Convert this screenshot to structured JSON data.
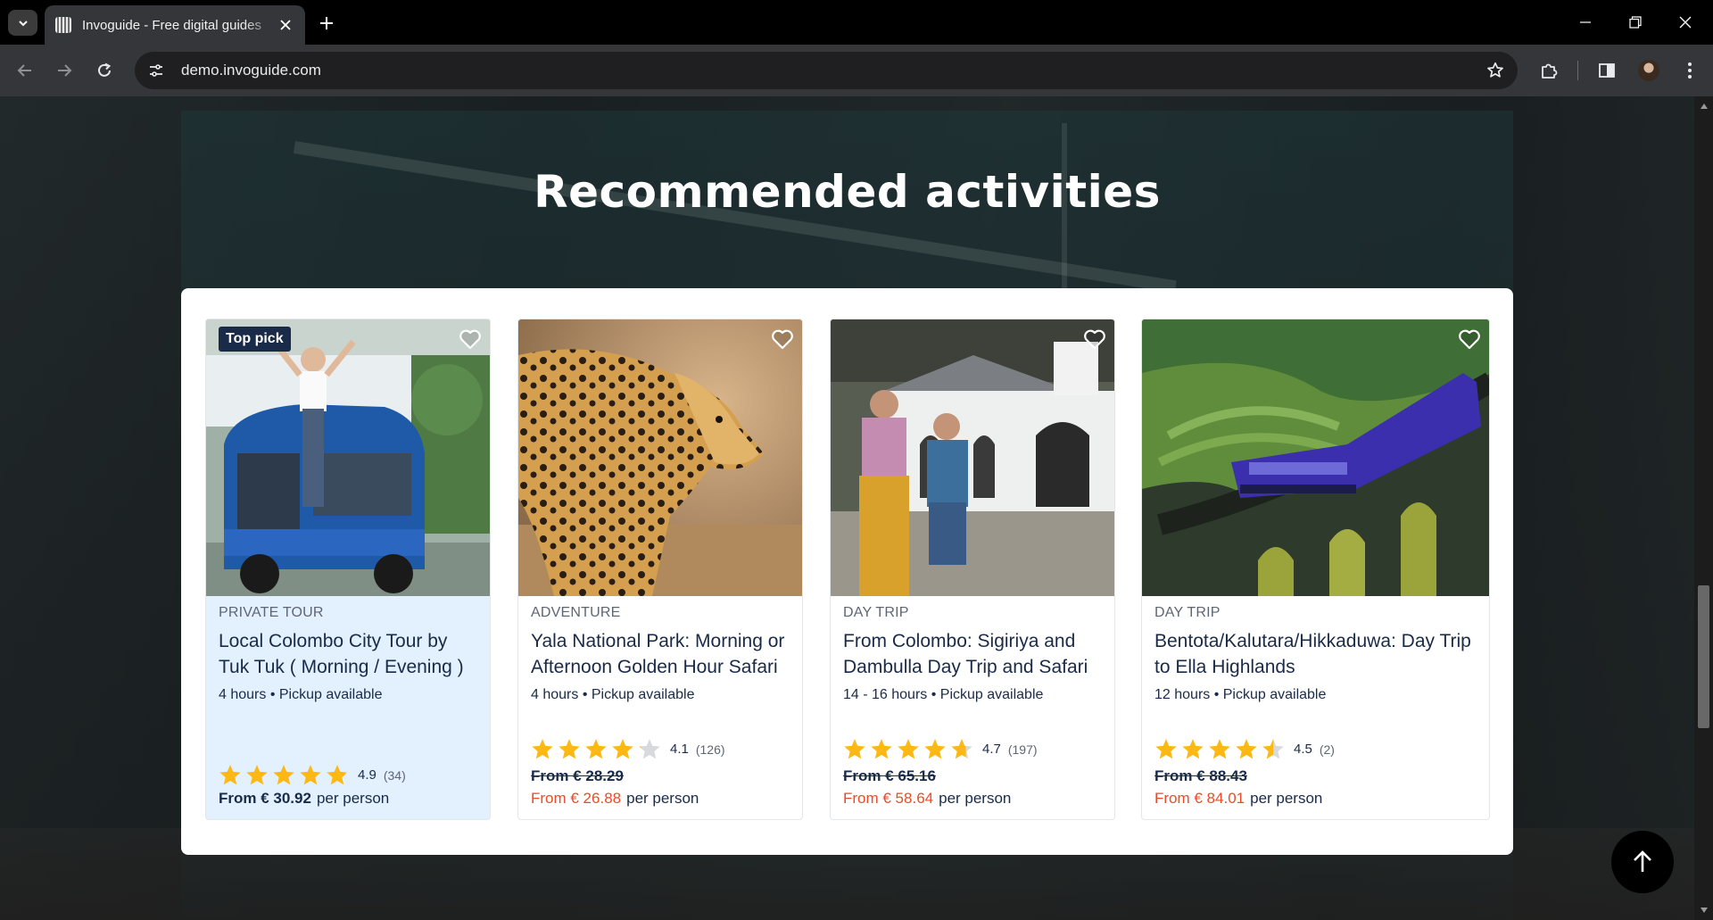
{
  "browser": {
    "tab_title": "Invoguide - Free digital guides",
    "url": "demo.invoguide.com"
  },
  "page": {
    "section_title": "Recommended activities"
  },
  "cards": [
    {
      "badge": "Top pick",
      "category": "PRIVATE TOUR",
      "title": "Local Colombo City Tour by Tuk Tuk ( Morning / Evening )",
      "meta": "4 hours • Pickup available",
      "rating": 4.9,
      "rating_value": "4.9",
      "rating_count": "(34)",
      "old_price": "",
      "price": "From € 30.92",
      "per": "per person",
      "highlight": true
    },
    {
      "category": "ADVENTURE",
      "title": "Yala National Park: Morning or Afternoon Golden Hour Safari",
      "meta": "4 hours • Pickup available",
      "rating": 4.1,
      "rating_value": "4.1",
      "rating_count": "(126)",
      "old_price": "From € 28.29",
      "price": "From € 26.88",
      "per": "per person"
    },
    {
      "category": "DAY TRIP",
      "title": "From Colombo: Sigiriya and Dambulla Day Trip and Safari",
      "meta": "14 - 16 hours • Pickup available",
      "rating": 4.7,
      "rating_value": "4.7",
      "rating_count": "(197)",
      "old_price": "From € 65.16",
      "price": "From € 58.64",
      "per": "per person"
    },
    {
      "category": "DAY TRIP",
      "title": "Bentota/Kalutara/Hikkaduwa: Day Trip to Ella Highlands",
      "meta": "12 hours • Pickup available",
      "rating": 4.5,
      "rating_value": "4.5",
      "rating_count": "(2)",
      "old_price": "From € 88.43",
      "price": "From € 84.01",
      "per": "per person"
    }
  ],
  "colors": {
    "navy": "#1a2b49",
    "sale": "#eb4b29",
    "star": "#fdb813",
    "highlight_bg": "#e3f0fd"
  }
}
